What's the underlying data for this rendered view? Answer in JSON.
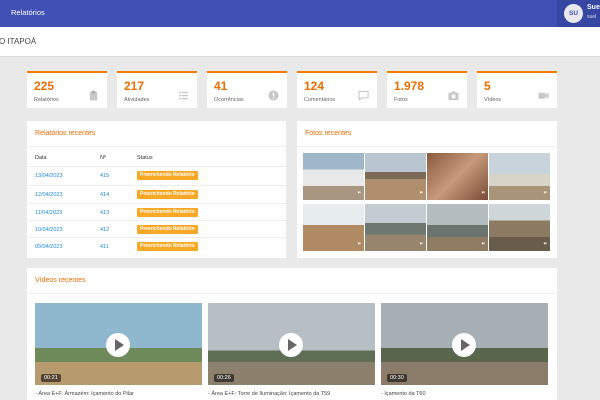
{
  "header": {
    "title": "Relatórios",
    "user_initials": "SU",
    "user_name": "Sue",
    "user_email": "suel"
  },
  "project": {
    "name": "O ITAPOÁ"
  },
  "stats": [
    {
      "value": "225",
      "label": "Relatórios",
      "icon": "clipboard-icon"
    },
    {
      "value": "217",
      "label": "Atividades",
      "icon": "list-icon"
    },
    {
      "value": "41",
      "label": "Ocorrências",
      "icon": "alert-icon"
    },
    {
      "value": "124",
      "label": "Comentários",
      "icon": "comment-icon"
    },
    {
      "value": "1.978",
      "label": "Fotos",
      "icon": "camera-icon"
    },
    {
      "value": "5",
      "label": "Vídeos",
      "icon": "video-camera-icon"
    }
  ],
  "reports": {
    "title": "Relatórios recentes",
    "columns": [
      "Data",
      "Nº",
      "Status"
    ],
    "rows": [
      {
        "date": "13/04/2023",
        "number": "415",
        "status": "Preenchendo Relatório"
      },
      {
        "date": "12/04/2023",
        "number": "414",
        "status": "Preenchendo Relatório"
      },
      {
        "date": "11/04/2023",
        "number": "413",
        "status": "Preenchendo Relatório"
      },
      {
        "date": "10/04/2023",
        "number": "412",
        "status": "Preenchendo Relatório"
      },
      {
        "date": "09/04/2023",
        "number": "411",
        "status": "Preenchendo Relatório"
      }
    ]
  },
  "photos": {
    "title": "Fotos recentes",
    "badge": "❞"
  },
  "videos": {
    "title": "Vídeos recentes",
    "items": [
      {
        "duration": "00:21",
        "caption": "- Área E+F: Armazém: Içamento do Pilar"
      },
      {
        "duration": "00:26",
        "caption": "- Área E+F: Torre de Iluminação: Içamento da T59"
      },
      {
        "duration": "00:30",
        "caption": "- Içamento da T60"
      }
    ]
  },
  "colors": {
    "topbar": "#3f51b5",
    "accent": "#ef6c00",
    "link": "#1e88e5",
    "status_badge": "#f9a825"
  }
}
